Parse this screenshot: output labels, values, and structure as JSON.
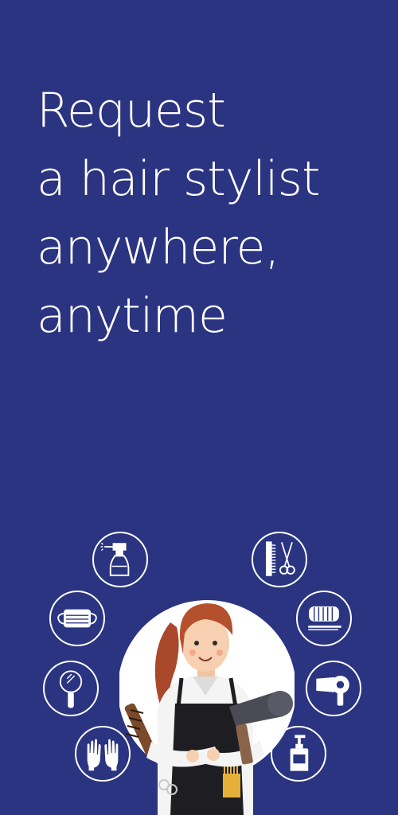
{
  "headline": {
    "lines": [
      "Request",
      "a hair stylist",
      "anywhere,",
      "anytime"
    ]
  },
  "illustration": {
    "tools_left": [
      "spray-bottle-icon",
      "face-mask-icon",
      "hand-mirror-icon",
      "gloves-icon"
    ],
    "tools_right": [
      "comb-and-scissors-icon",
      "hair-rollers-icon",
      "hair-dryer-icon",
      "pump-bottle-icon"
    ],
    "colors": {
      "background": "#2b3481",
      "line_icons": "#ffffff",
      "hair": "#b5502d",
      "apron": "#1e1e22"
    }
  }
}
